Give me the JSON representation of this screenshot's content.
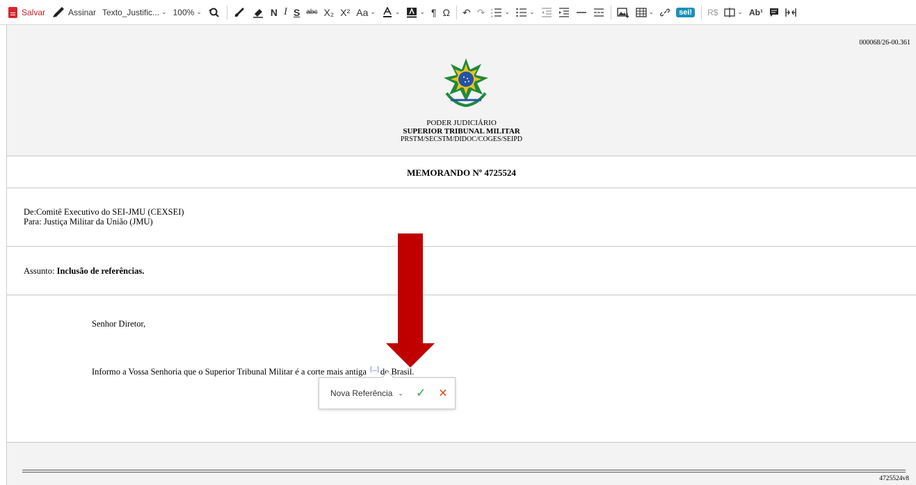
{
  "toolbar": {
    "save_label": "Salvar",
    "sign_label": "Assinar",
    "style_value": "Texto_Justific...",
    "zoom_value": "100%",
    "bold_glyph": "N",
    "italic_glyph": "I",
    "underline_glyph": "S",
    "strike_glyph": "abc",
    "subscript_glyph": "X₂",
    "superscript_glyph": "X²",
    "fontsize_glyph": "Aa",
    "pilcrow_glyph": "¶",
    "omega_glyph": "Ω",
    "sei_label": "sei!",
    "currency_label": "R$",
    "abbr_glyph": "Ab¹",
    "icons": [
      "document-save-icon",
      "pen-icon",
      "find-replace-icon",
      "paintbrush-icon",
      "eraser-icon",
      "text-color-icon",
      "highlight-icon",
      "undo-icon",
      "redo-icon",
      "numbered-list-icon",
      "bulleted-list-icon",
      "outdent-icon",
      "indent-icon",
      "horizontal-line-icon",
      "page-break-icon",
      "image-icon",
      "table-icon",
      "link-icon",
      "columns-icon",
      "comment-icon",
      "split-icon"
    ]
  },
  "document": {
    "protocol_number": "000068/26-00.361",
    "crest_icon": "brazil-coat-of-arms-icon",
    "header": {
      "line1": "PODER JUDICIÁRIO",
      "line2": "SUPERIOR TRIBUNAL MILITAR",
      "line3": "PRSTM/SECSTM/DIDOC/COGES/SEIPD"
    },
    "title": "MEMORANDO Nº 4725524",
    "from": "De:Comitê Executivo do SEI-JMU (CEXSEI)",
    "to": "Para: Justiça Militar da União (JMU)",
    "subject_label": "Assunto: ",
    "subject_value": "Inclusão de referências.",
    "greeting": "Senhor Diretor,",
    "body_before": "Informo a Vossa Senhoria que o Superior Tribunal Militar é a corte mais antiga",
    "reference_marker": "[...]",
    "body_after": "do Brasil.",
    "footer_code": "4725524v8"
  },
  "reference_popup": {
    "select_value": "Nova Referência",
    "confirm_icon": "check-icon",
    "cancel_icon": "close-icon"
  },
  "colors": {
    "save_red": "#d9262c",
    "annotation_arrow": "#c00000",
    "confirm_green": "#27a33a",
    "cancel_orange": "#e04b1c",
    "reference_blue": "#2e4fc7",
    "sei_blue": "#1d8fb8"
  }
}
